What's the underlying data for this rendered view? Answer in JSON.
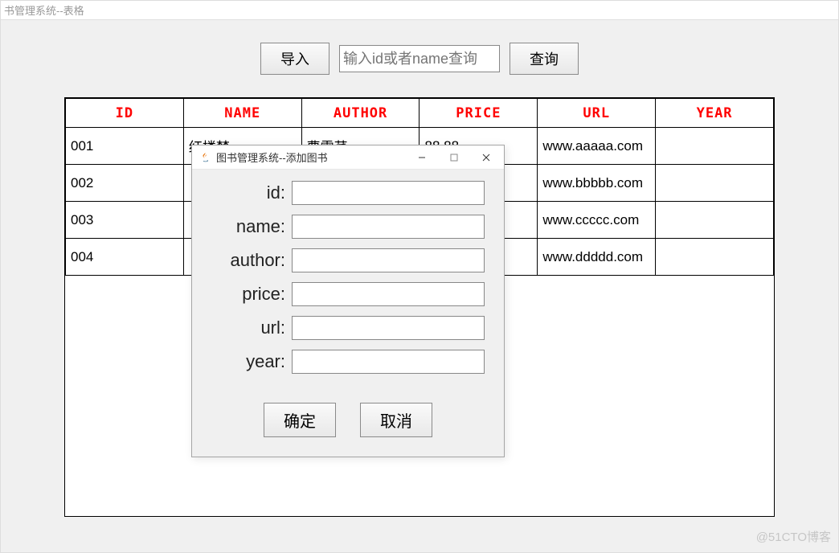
{
  "main": {
    "title": "书管理系统--表格",
    "toolbar": {
      "import_label": "导入",
      "search_placeholder": "输入id或者name查询",
      "search_value": "",
      "query_label": "查询"
    },
    "table": {
      "headers": [
        "ID",
        "NAME",
        "AUTHOR",
        "PRICE",
        "URL",
        "YEAR"
      ],
      "rows": [
        {
          "id": "001",
          "name": "红楼梦",
          "author": "曹雪芹",
          "price": "88.88",
          "url": "www.aaaaa.com",
          "year": ""
        },
        {
          "id": "002",
          "name": "",
          "author": "",
          "price": "",
          "url": "www.bbbbb.com",
          "year": ""
        },
        {
          "id": "003",
          "name": "",
          "author": "",
          "price": "",
          "url": "www.ccccc.com",
          "year": ""
        },
        {
          "id": "004",
          "name": "",
          "author": "",
          "price": "",
          "url": "www.ddddd.com",
          "year": ""
        }
      ]
    }
  },
  "dialog": {
    "title": "图书管理系统--添加图书",
    "fields": {
      "id_label": "id:",
      "name_label": "name:",
      "author_label": "author:",
      "price_label": "price:",
      "url_label": "url:",
      "year_label": "year:",
      "id_value": "",
      "name_value": "",
      "author_value": "",
      "price_value": "",
      "url_value": "",
      "year_value": ""
    },
    "ok_label": "确定",
    "cancel_label": "取消"
  },
  "watermark": "@51CTO博客"
}
